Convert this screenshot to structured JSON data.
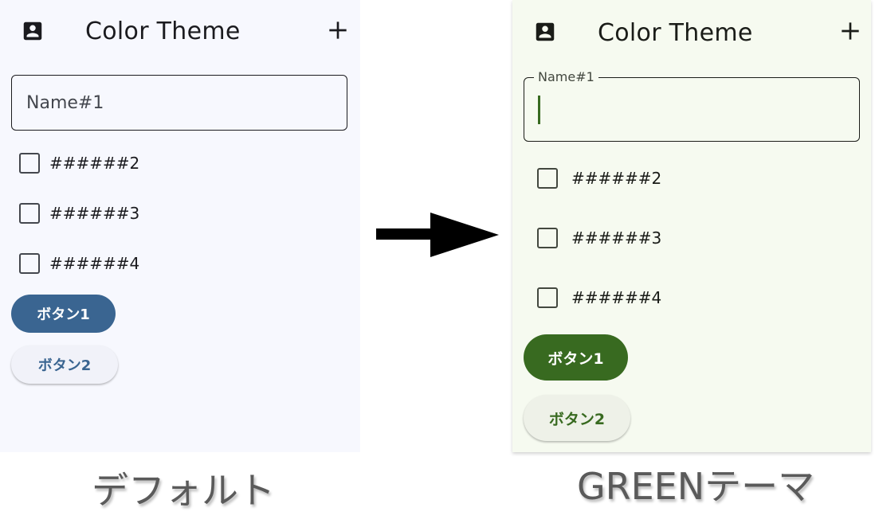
{
  "left_panel": {
    "app_title": "Color Theme",
    "account_icon": "account-box-icon",
    "add_icon": "plus-icon",
    "name_field": {
      "placeholder": "Name#1",
      "value": ""
    },
    "checkboxes": [
      {
        "label": "######2",
        "checked": false
      },
      {
        "label": "######3",
        "checked": false
      },
      {
        "label": "######4",
        "checked": false
      }
    ],
    "button1_label": "ボタン1",
    "button2_label": "ボタン2",
    "caption": "デフォルト",
    "colors": {
      "background": "#f7f8fe",
      "primary": "#3a6591",
      "tonal_button": "#f1f2f9",
      "text": "#1b1b1f"
    }
  },
  "right_panel": {
    "app_title": "Color Theme",
    "account_icon": "account-box-icon",
    "add_icon": "plus-icon",
    "name_field": {
      "label": "Name#1",
      "value": "",
      "focused": true
    },
    "checkboxes": [
      {
        "label": "######2",
        "checked": false
      },
      {
        "label": "######3",
        "checked": false
      },
      {
        "label": "######4",
        "checked": false
      }
    ],
    "button1_label": "ボタン1",
    "button2_label": "ボタン2",
    "caption": "GREENテーマ",
    "colors": {
      "background": "#f6faf0",
      "primary": "#386a20",
      "tonal_button": "#eef1e8",
      "text": "#1a1c18"
    }
  },
  "arrow_icon": "right-arrow-icon"
}
